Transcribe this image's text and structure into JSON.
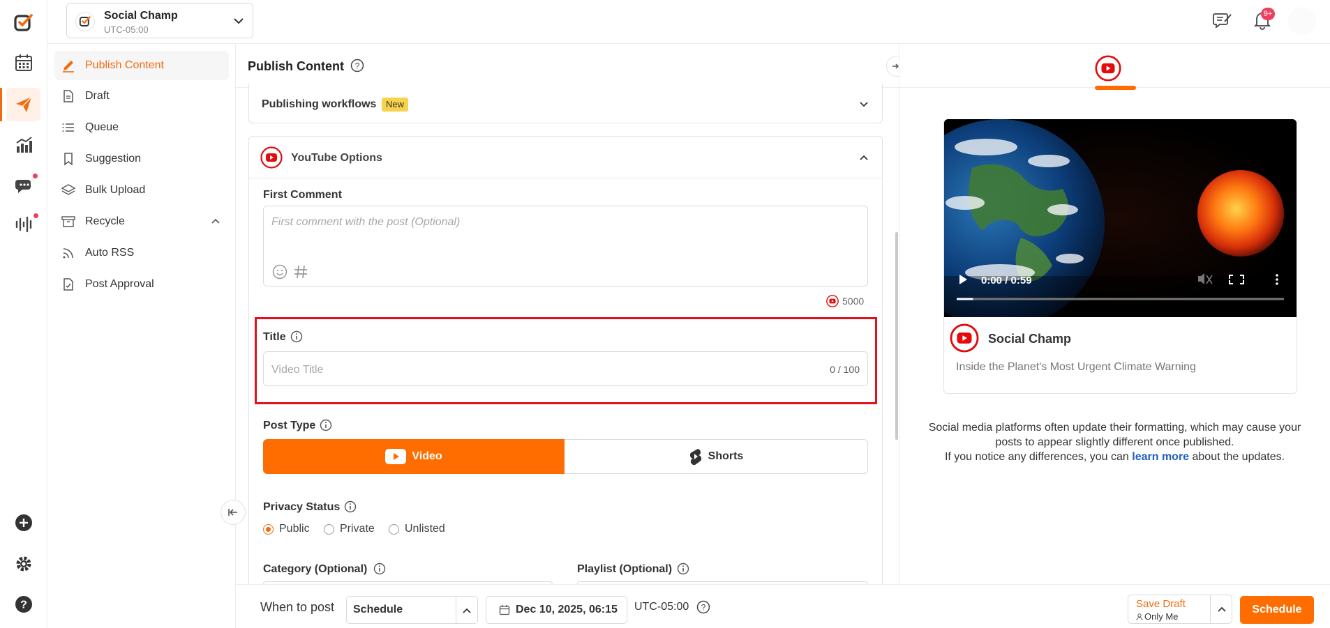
{
  "account": {
    "name": "Social Champ",
    "timezone": "UTC-05:00"
  },
  "header": {
    "notification_count": "9+"
  },
  "sidebar": {
    "items": [
      {
        "label": "Publish Content"
      },
      {
        "label": "Draft"
      },
      {
        "label": "Queue"
      },
      {
        "label": "Suggestion"
      },
      {
        "label": "Bulk Upload"
      },
      {
        "label": "Recycle"
      },
      {
        "label": "Auto RSS"
      },
      {
        "label": "Post Approval"
      }
    ]
  },
  "main": {
    "title": "Publish Content",
    "workflows": {
      "label": "Publishing workflows",
      "badge": "New"
    },
    "youtube_options": {
      "label": "YouTube Options"
    },
    "first_comment": {
      "label": "First Comment",
      "placeholder": "First comment with the post (Optional)",
      "char_limit": "5000"
    },
    "title_field": {
      "label": "Title",
      "placeholder": "Video Title",
      "counter": "0 / 100"
    },
    "post_type": {
      "label": "Post Type",
      "options": [
        "Video",
        "Shorts"
      ],
      "selected": "Video"
    },
    "privacy": {
      "label": "Privacy Status",
      "options": [
        "Public",
        "Private",
        "Unlisted"
      ],
      "selected": "Public"
    },
    "category_label": "Category (Optional)",
    "playlist_label": "Playlist (Optional)"
  },
  "bottom": {
    "when_label": "When to post",
    "mode": "Schedule",
    "datetime": "Dec 10, 2025, 06:15",
    "timezone": "UTC-05:00",
    "save_draft": "Save Draft",
    "visibility": "Only Me",
    "schedule_button": "Schedule"
  },
  "preview": {
    "video_time": "0:00 / 0:59",
    "video_progress": 0,
    "channel_name": "Social Champ",
    "video_title": "Inside the Planet's Most Urgent Climate Warning",
    "notice_line1": "Social media platforms often update their formatting, which may cause your",
    "notice_line2": "posts to appear slightly different once published.",
    "notice_line3_pre": "If you notice any differences, you can ",
    "notice_link": "learn more",
    "notice_line3_post": " about the updates."
  },
  "colors": {
    "accent": "#f26b0f",
    "youtube": "#e30b0b",
    "link": "#1f5fbf",
    "highlight_box": "#e0121d",
    "badge": "#f7d24a"
  }
}
